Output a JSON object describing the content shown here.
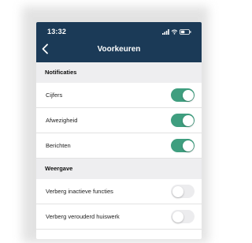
{
  "status_bar": {
    "time": "13:32",
    "icons": [
      "signal-icon",
      "wifi-icon",
      "battery-icon"
    ]
  },
  "navbar": {
    "title": "Voorkeuren",
    "back_icon": "chevron-left-icon"
  },
  "colors": {
    "header_bg": "#1b3a57",
    "toggle_on": "#3f9e7f",
    "toggle_off": "#ececee",
    "section_bg": "#eeeef0"
  },
  "sections": [
    {
      "title": "Notificaties",
      "items": [
        {
          "label": "Cijfers",
          "enabled": true
        },
        {
          "label": "Afwezigheid",
          "enabled": true
        },
        {
          "label": "Berichten",
          "enabled": true
        }
      ]
    },
    {
      "title": "Weergave",
      "items": [
        {
          "label": "Verberg inactieve functies",
          "enabled": false
        },
        {
          "label": "Verberg verouderd huiswerk",
          "enabled": false
        }
      ]
    }
  ]
}
